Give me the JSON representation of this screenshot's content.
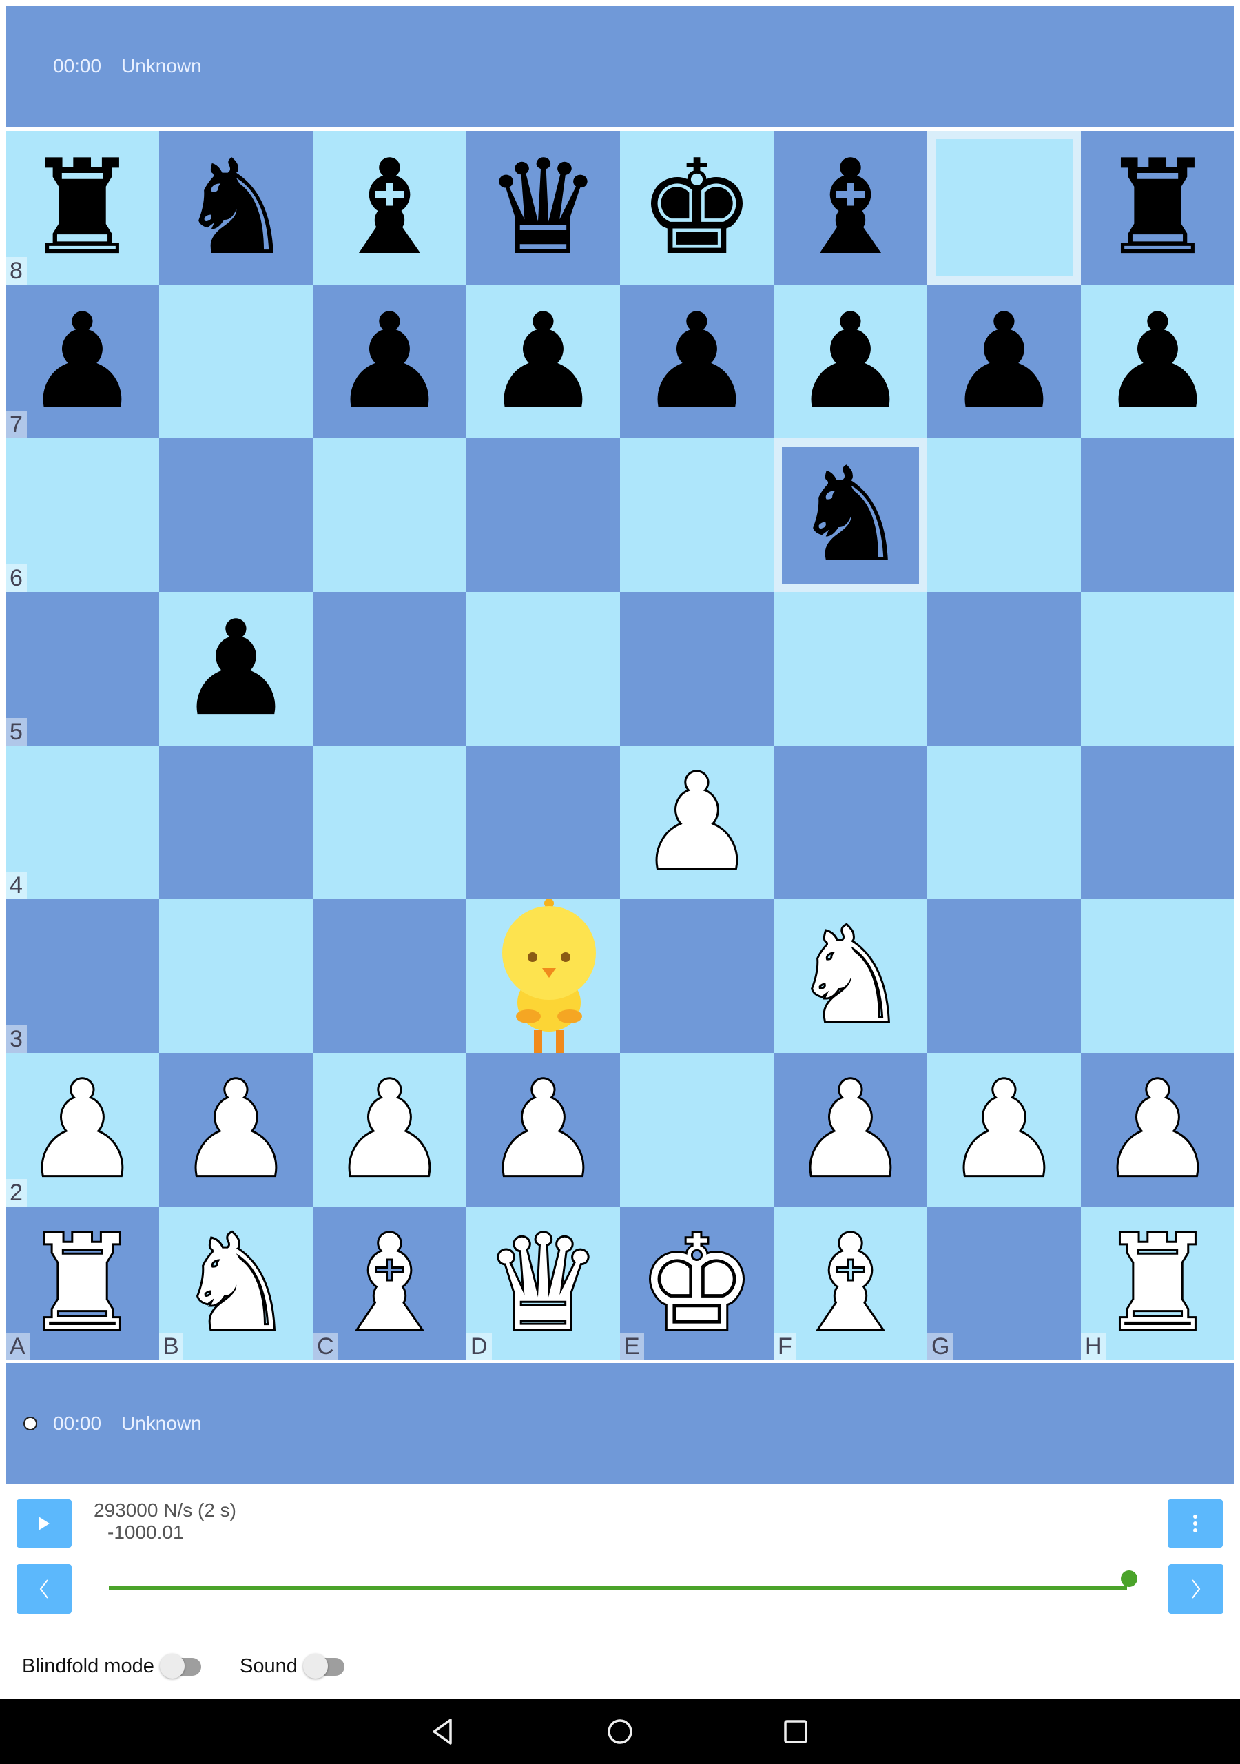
{
  "top_player": {
    "clock": "00:00",
    "name": "Unknown"
  },
  "bottom_player": {
    "clock": "00:00",
    "name": "Unknown",
    "to_move": true
  },
  "board": {
    "ranks": [
      "8",
      "7",
      "6",
      "5",
      "4",
      "3",
      "2",
      "1"
    ],
    "files": [
      "A",
      "B",
      "C",
      "D",
      "E",
      "F",
      "G",
      "H"
    ],
    "position": [
      "rnbqkb.r",
      "p.pppppp",
      ".....n..",
      ".p......",
      "....P...",
      "...@.N..",
      "PPPP.PPP",
      "RNBQKB.R"
    ],
    "highlighted_squares": [
      "g8",
      "f6"
    ],
    "colors": {
      "light": "#aee6fb",
      "dark": "#7099d8",
      "highlight": "#d9eefa"
    },
    "duck_square": "d3"
  },
  "engine": {
    "speed": "293000 N/s (2 s)",
    "score": "-1000.01"
  },
  "controls": {
    "play_icon": "play-icon",
    "menu_icon": "more-vertical-icon",
    "prev_icon": "chevron-left-icon",
    "next_icon": "chevron-right-icon",
    "move_slider_progress": 1.0,
    "accent": "#5cb8fc",
    "slider_color": "#4aa32a"
  },
  "toggles": [
    {
      "label": "Blindfold mode",
      "on": false
    },
    {
      "label": "Sound",
      "on": false
    }
  ],
  "navbar": {
    "icons": [
      "back-icon",
      "home-icon",
      "recents-icon"
    ]
  }
}
